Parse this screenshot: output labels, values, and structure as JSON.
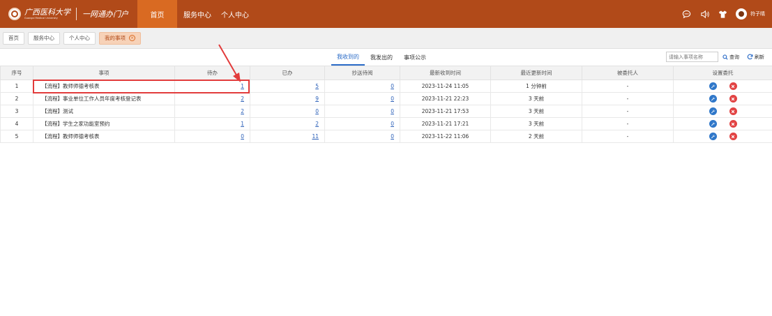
{
  "header": {
    "university": "广西医科大学",
    "university_en": "Guangxi Medical University",
    "portal": "一网通办门户",
    "nav": [
      {
        "label": "首页",
        "active": true
      },
      {
        "label": "服务中心",
        "active": false
      },
      {
        "label": "个人中心",
        "active": false
      }
    ],
    "icons": [
      "chat-icon",
      "speaker-icon",
      "shirt-icon",
      "user-avatar-icon"
    ],
    "username": "符子晴"
  },
  "page_tabs": [
    {
      "label": "首页",
      "active": false
    },
    {
      "label": "服务中心",
      "active": false
    },
    {
      "label": "个人中心",
      "active": false
    },
    {
      "label": "我的事项",
      "active": true
    }
  ],
  "sub_tabs": [
    {
      "label": "我收到的",
      "active": true
    },
    {
      "label": "我发出的",
      "active": false
    },
    {
      "label": "事项公示",
      "active": false
    }
  ],
  "search": {
    "placeholder": "请输入事项名称",
    "query_label": "查询",
    "refresh_label": "刷新"
  },
  "table": {
    "columns": [
      "序号",
      "事项",
      "待办",
      "已办",
      "抄送待阅",
      "最新收到时间",
      "最近更新时间",
      "被委托人",
      "设置委托"
    ],
    "rows": [
      {
        "no": "1",
        "item": "【流程】教师师德考核表",
        "todo": "1",
        "done": "5",
        "cc": "0",
        "received": "2023-11-24 11:05",
        "updated": "1 分钟前",
        "delegate": "-"
      },
      {
        "no": "2",
        "item": "【流程】事业单位工作人员年度考核登记表",
        "todo": "2",
        "done": "9",
        "cc": "0",
        "received": "2023-11-21 22:23",
        "updated": "3 天前",
        "delegate": "-"
      },
      {
        "no": "3",
        "item": "【流程】测试",
        "todo": "2",
        "done": "0",
        "cc": "0",
        "received": "2023-11-21 17:53",
        "updated": "3 天前",
        "delegate": "-"
      },
      {
        "no": "4",
        "item": "【流程】学生之家功能室预约",
        "todo": "1",
        "done": "2",
        "cc": "0",
        "received": "2023-11-21 17:21",
        "updated": "3 天前",
        "delegate": "-"
      },
      {
        "no": "5",
        "item": "【流程】教师师德考核表",
        "todo": "0",
        "done": "11",
        "cc": "0",
        "received": "2023-11-22 11:06",
        "updated": "2 天前",
        "delegate": "-"
      }
    ]
  },
  "colors": {
    "header_bg": "#b14a19",
    "nav_active": "#d96a22",
    "link": "#2a5fb8",
    "highlight": "#e23b3b"
  }
}
